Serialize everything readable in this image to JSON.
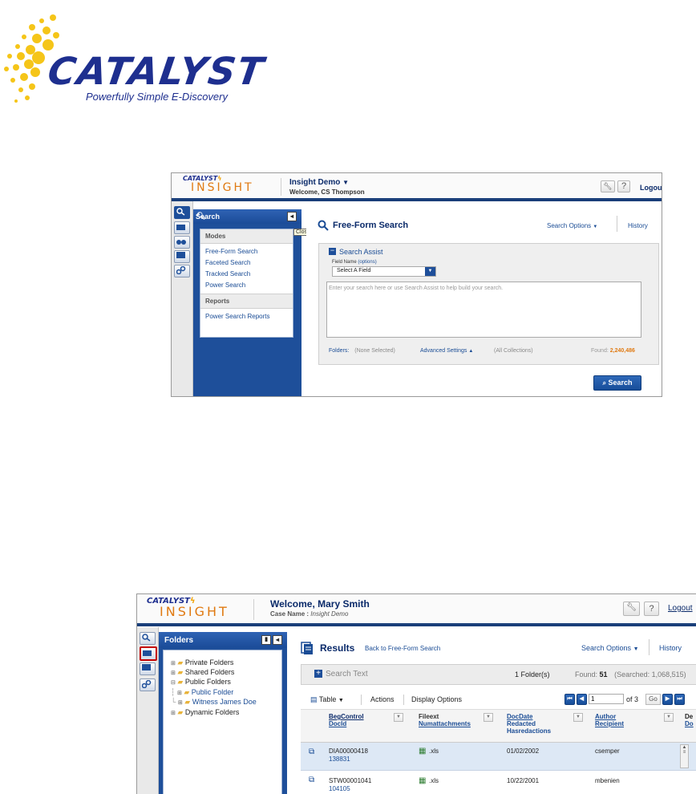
{
  "logo": {
    "name": "CATALYST",
    "tagline": "Powerfully Simple E-Discovery"
  },
  "colors": {
    "brand_blue": "#1e2f8f",
    "accent_orange": "#e07a12",
    "panel_blue": "#1e4f9a",
    "found_orange": "#e07a12"
  },
  "shot1": {
    "brand_top": "CATALYST",
    "brand_bottom": "INSIGHT",
    "case_name": "Insight Demo",
    "welcome": "Welcome, CS Thompson",
    "help_label": "?",
    "logout": "Logout",
    "panel_title": "Search",
    "tooltip": "Close",
    "menu": {
      "modes_header": "Modes",
      "modes": [
        "Free-Form Search",
        "Faceted Search",
        "Tracked Search",
        "Power Search"
      ],
      "reports_header": "Reports",
      "reports": [
        "Power Search Reports"
      ]
    },
    "main": {
      "title": "Free-Form Search",
      "search_options": "Search Options",
      "history": "History",
      "assist_label": "Search Assist",
      "field_name_label": "Field Name",
      "field_name_hint": "(options)",
      "select_value": "Select A Field",
      "placeholder": "Enter your search here or use Search Assist to help build your search.",
      "folders_label": "Folders:",
      "folders_value": "(None Selected)",
      "advanced": "Advanced Settings",
      "collections": "(All Collections)",
      "found_label": "Found:",
      "found_value": "2,240,486",
      "search_button": "Search"
    }
  },
  "shot2": {
    "brand_top": "CATALYST",
    "brand_bottom": "INSIGHT",
    "welcome": "Welcome, Mary Smith",
    "case_label": "Case Name :",
    "case_name": "Insight Demo",
    "help_label": "?",
    "logout": "Logout",
    "panel_title": "Folders",
    "tree": {
      "private": "Private Folders",
      "shared": "Shared Folders",
      "public": "Public Folders",
      "public_folder": "Public Folder",
      "witness": "Witness James Doe",
      "dynamic": "Dynamic Folders"
    },
    "results": {
      "title": "Results",
      "back_link": "Back to Free-Form Search",
      "search_options": "Search Options",
      "history": "History",
      "search_text": "Search Text",
      "folders_count": "1 Folder(s)",
      "found_label": "Found:",
      "found_value": "51",
      "searched": "(Searched: 1,068,515)",
      "view_label": "Table",
      "actions": "Actions",
      "display_options": "Display Options",
      "page_value": "1",
      "page_of": "of 3",
      "go": "Go"
    },
    "columns": [
      {
        "line1": "BegControl",
        "line2": "DocId",
        "line3": "",
        "line4": ""
      },
      {
        "line1": "Fileext",
        "line2": "Numattachments",
        "line3": "",
        "line4": ""
      },
      {
        "line1": "DocDate",
        "line2": "Redacted",
        "line3": "Hasredactions",
        "line4": ""
      },
      {
        "line1": "Author",
        "line2": "Recipient",
        "line3": "",
        "line4": ""
      },
      {
        "line1": "De",
        "line2": "Do",
        "line3": "",
        "line4": ""
      }
    ],
    "rows": [
      {
        "beg": "DIA00000418",
        "docid": "138831",
        "ext": ".xls",
        "date": "01/02/2002",
        "author": "csemper"
      },
      {
        "beg": "STW00001041",
        "docid": "104105",
        "ext": ".xls",
        "date": "10/22/2001",
        "author": "mbenien"
      }
    ]
  }
}
